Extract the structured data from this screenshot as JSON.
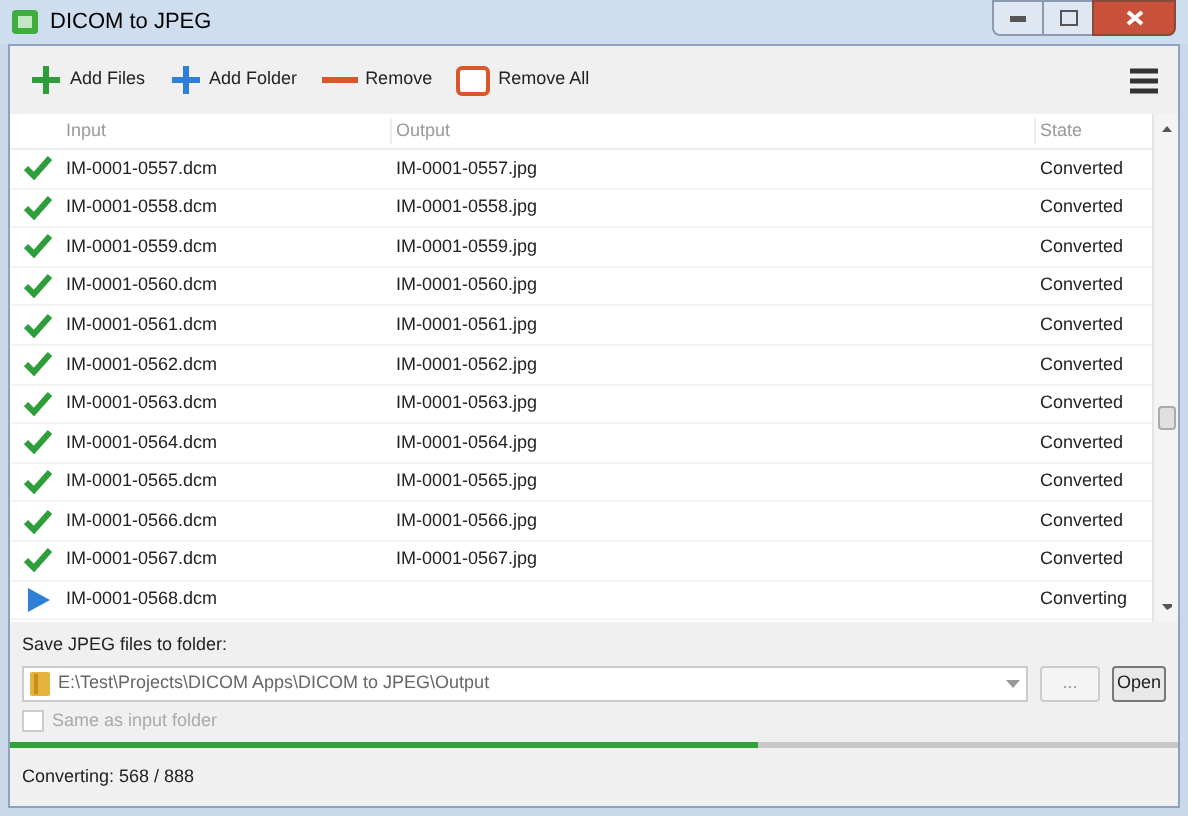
{
  "window": {
    "title": "DICOM to JPEG"
  },
  "toolbar": [
    {
      "kind": "add",
      "label": "Add Files"
    },
    {
      "kind": "folder",
      "label": "Add Folder"
    },
    {
      "kind": "remove",
      "label": "Remove"
    },
    {
      "kind": "removeall",
      "label": "Remove All"
    }
  ],
  "table": {
    "columns": [
      "Input",
      "Output",
      "State"
    ],
    "rows": [
      {
        "kind": "done",
        "input": "IM-0001-0557.dcm",
        "output": "IM-0001-0557.jpg",
        "state": "Converted"
      },
      {
        "kind": "done",
        "input": "IM-0001-0558.dcm",
        "output": "IM-0001-0558.jpg",
        "state": "Converted"
      },
      {
        "kind": "done",
        "input": "IM-0001-0559.dcm",
        "output": "IM-0001-0559.jpg",
        "state": "Converted"
      },
      {
        "kind": "done",
        "input": "IM-0001-0560.dcm",
        "output": "IM-0001-0560.jpg",
        "state": "Converted"
      },
      {
        "kind": "done",
        "input": "IM-0001-0561.dcm",
        "output": "IM-0001-0561.jpg",
        "state": "Converted"
      },
      {
        "kind": "done",
        "input": "IM-0001-0562.dcm",
        "output": "IM-0001-0562.jpg",
        "state": "Converted"
      },
      {
        "kind": "done",
        "input": "IM-0001-0563.dcm",
        "output": "IM-0001-0563.jpg",
        "state": "Converted"
      },
      {
        "kind": "done",
        "input": "IM-0001-0564.dcm",
        "output": "IM-0001-0564.jpg",
        "state": "Converted"
      },
      {
        "kind": "done",
        "input": "IM-0001-0565.dcm",
        "output": "IM-0001-0565.jpg",
        "state": "Converted"
      },
      {
        "kind": "done",
        "input": "IM-0001-0566.dcm",
        "output": "IM-0001-0566.jpg",
        "state": "Converted"
      },
      {
        "kind": "done",
        "input": "IM-0001-0567.dcm",
        "output": "IM-0001-0567.jpg",
        "state": "Converted"
      },
      {
        "kind": "running",
        "input": "IM-0001-0568.dcm",
        "state": "Converting"
      }
    ]
  },
  "save": {
    "label": "Save JPEG files to folder:",
    "path": "E:\\Test\\Projects\\DICOM Apps\\DICOM to JPEG\\Output",
    "browse": "...",
    "open": "Open",
    "same_label": "Same as input folder",
    "same_checked": false,
    "same_disabled": true
  },
  "progress": {
    "level": 0.64
  },
  "status_bar": "Converting: 568 / 888"
}
